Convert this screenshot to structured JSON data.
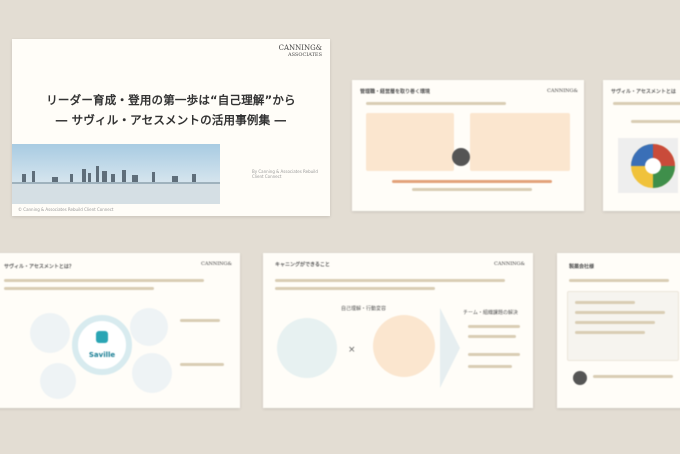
{
  "slide1": {
    "brand_line1": "CANNING&",
    "brand_line2": "ASSOCIATES",
    "title_line1": "リーダー育成・登用の第一歩は“自己理解”から",
    "title_line2": "― サヴィル・アセスメントの活用事例集 ―",
    "caption": "© Canning & Associates Rebuild Client Connect"
  },
  "slide2": {
    "title": "管理職・経営層を取り巻く環境"
  },
  "slide3": {
    "title": "サヴィル・アセスメントとは"
  },
  "slide4": {
    "title": "サヴィル・アセスメントとは？",
    "logo_text": "Saville"
  },
  "slide5": {
    "title": "キャニングができること",
    "center_head": "自己理解・行動変容",
    "right_head": "チーム・組織課題の解決",
    "cross": "×"
  },
  "slide6": {
    "title": "製薬会社様"
  }
}
